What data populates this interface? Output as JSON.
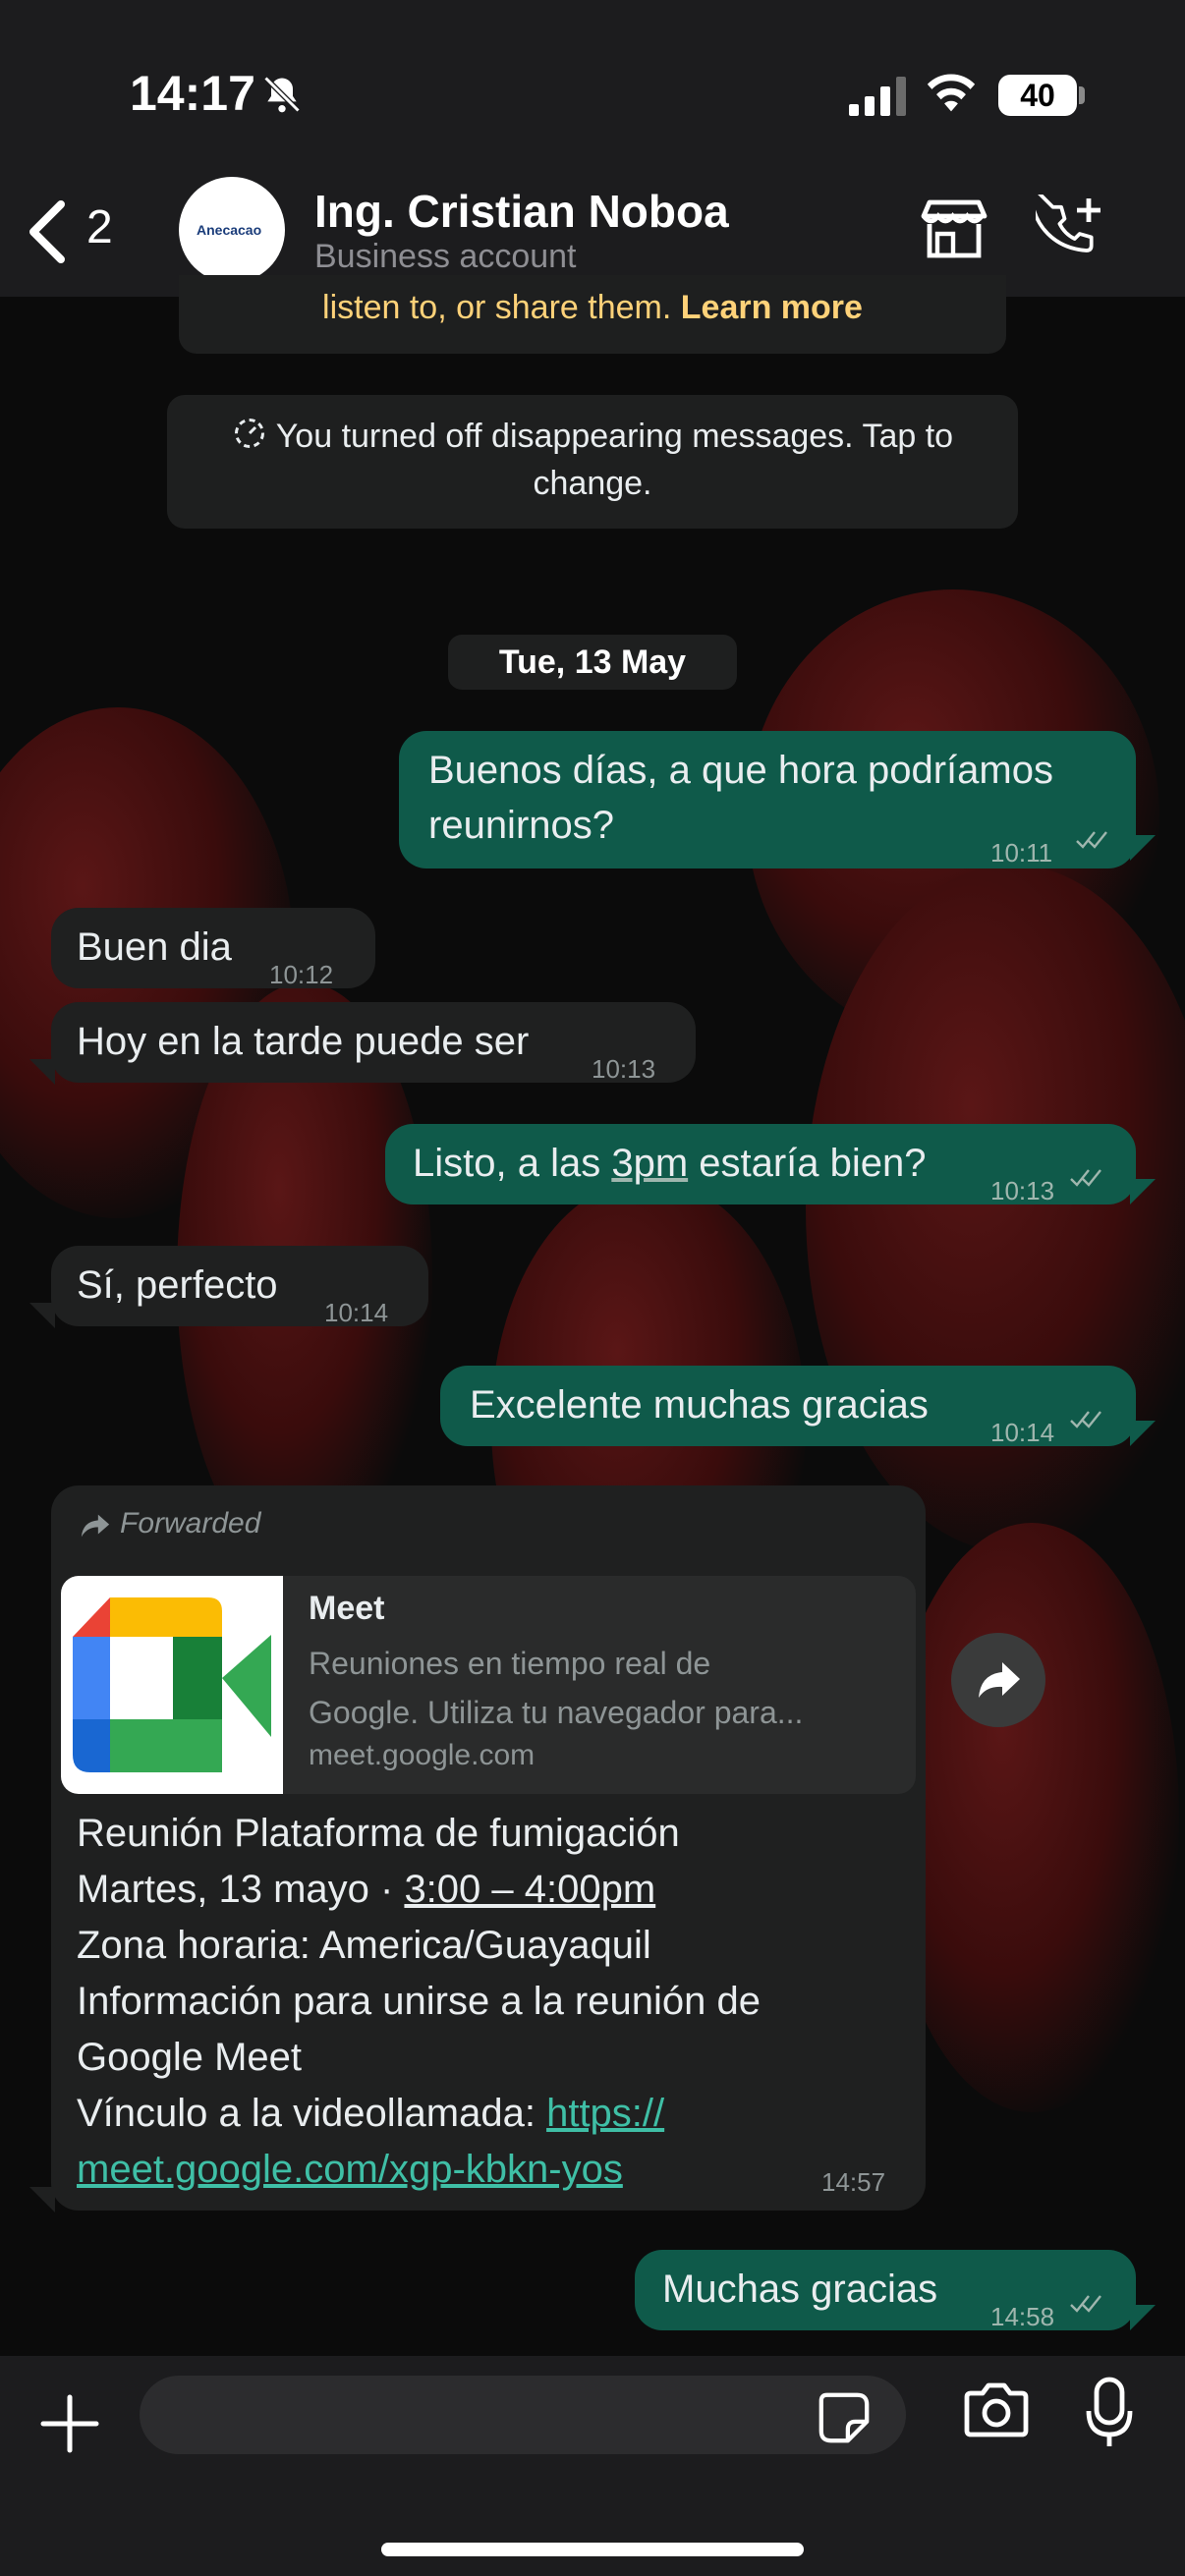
{
  "status_bar": {
    "time": "14:17",
    "battery": "40"
  },
  "header": {
    "back_count": "2",
    "avatar_logo": "Anecacao",
    "contact_name": "Ing. Cristian Noboa",
    "contact_subtitle": "Business account"
  },
  "notices": {
    "encryption_partial": "listen to, or share them.",
    "learn_more": "Learn more",
    "disappearing": "You turned off disappearing messages. Tap to change."
  },
  "date_chip": "Tue, 13 May",
  "messages": [
    {
      "dir": "out",
      "text_line1": "Buenos días, a que hora podríamos",
      "text_line2": "reunirnos?",
      "time": "10:11"
    },
    {
      "dir": "in",
      "text": "Buen dia",
      "time": "10:12"
    },
    {
      "dir": "in",
      "text": "Hoy en la tarde puede ser",
      "time": "10:13"
    },
    {
      "dir": "out",
      "text_pre": "Listo, a las ",
      "text_link": "3pm",
      "text_post": " estaría bien?",
      "time": "10:13"
    },
    {
      "dir": "in",
      "text": "Sí, perfecto",
      "time": "10:14"
    },
    {
      "dir": "out",
      "text": "Excelente muchas gracias",
      "time": "10:14"
    },
    {
      "dir": "out",
      "text": "Muchas gracias",
      "time": "14:58"
    }
  ],
  "forwarded": {
    "label": "Forwarded",
    "preview_title": "Meet",
    "preview_desc_line1": "Reuniones en tiempo real de",
    "preview_desc_line2": "Google. Utiliza tu navegador para...",
    "preview_url": "meet.google.com",
    "body_line1": "Reunión Plataforma de fumigación",
    "body_line2_pre": "Martes, 13 mayo · ",
    "body_line2_link": "3:00 – 4:00pm",
    "body_line3": "Zona horaria: America/Guayaquil",
    "body_line4": "Información para unirse a la reunión de",
    "body_line5": "Google Meet",
    "body_line6_pre": "Vínculo a la videollamada: ",
    "body_line6_link": "https://",
    "body_line7_link": "meet.google.com/xgp-kbkn-yos",
    "time": "14:57"
  },
  "colors": {
    "outgoing_bubble": "#0f5a4a",
    "incoming_bubble": "#1f2020",
    "accent_link": "#3fbfa6",
    "notice_text": "#ffd279"
  },
  "icons": [
    "bell-slash-icon",
    "signal-icon",
    "wifi-icon",
    "back-chevron-icon",
    "store-icon",
    "add-call-icon",
    "forward-arrow-icon",
    "share-icon",
    "plus-icon",
    "sticker-icon",
    "camera-icon",
    "microphone-icon",
    "double-check-icon"
  ]
}
